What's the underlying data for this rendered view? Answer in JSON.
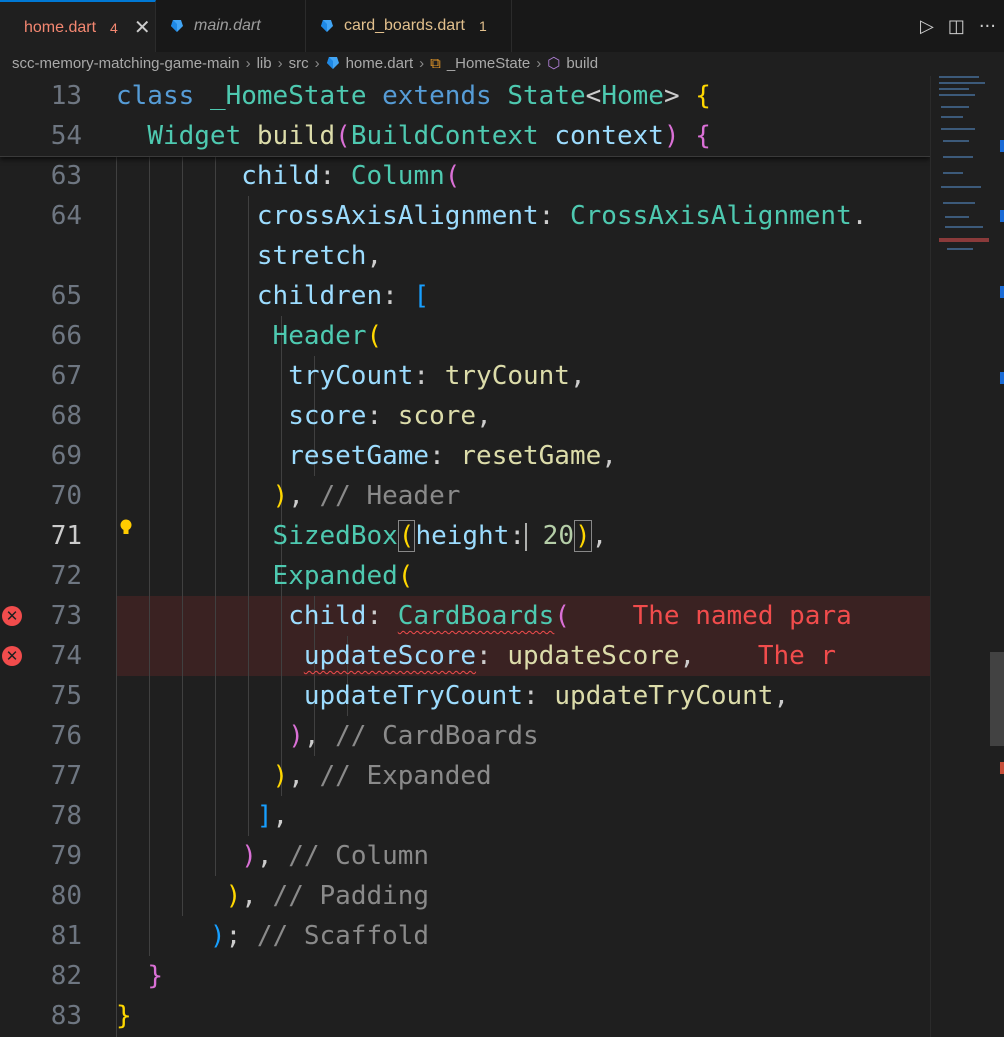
{
  "tabs": [
    {
      "label": "home.dart",
      "badge": "4",
      "state": "error",
      "active": true
    },
    {
      "label": "main.dart",
      "badge": "",
      "state": "plain",
      "active": false
    },
    {
      "label": "card_boards.dart",
      "badge": "1",
      "state": "warning",
      "active": false
    }
  ],
  "tab_actions": {
    "run": "▷",
    "split": "◫",
    "more": "···"
  },
  "breadcrumb": [
    "scc-memory-matching-game-main",
    "lib",
    "src",
    "home.dart",
    "_HomeState",
    "build"
  ],
  "sticky": [
    {
      "num": "13"
    },
    {
      "num": "54"
    }
  ],
  "lines": [
    {
      "num": "63"
    },
    {
      "num": "64"
    },
    {
      "num": ""
    },
    {
      "num": "65"
    },
    {
      "num": "66"
    },
    {
      "num": "67"
    },
    {
      "num": "68"
    },
    {
      "num": "69"
    },
    {
      "num": "70"
    },
    {
      "num": "71"
    },
    {
      "num": "72"
    },
    {
      "num": "73"
    },
    {
      "num": "74"
    },
    {
      "num": "75"
    },
    {
      "num": "76"
    },
    {
      "num": "77"
    },
    {
      "num": "78"
    },
    {
      "num": "79"
    },
    {
      "num": "80"
    },
    {
      "num": "81"
    },
    {
      "num": "82"
    },
    {
      "num": "83"
    }
  ],
  "code": {
    "l13": {
      "t1": "class",
      "t2": "_HomeState",
      "t3": "extends",
      "t4": "State",
      "t5": "<",
      "t6": "Home",
      "t7": ">",
      "t8": "{"
    },
    "l54": {
      "t1": "Widget",
      "t2": "build",
      "t3": "(",
      "t4": "BuildContext",
      "t5": "context",
      "t6": ")",
      "t7": "{"
    },
    "l63": {
      "t1": "child",
      "t2": ": ",
      "t3": "Column",
      "t4": "("
    },
    "l64": {
      "t1": "crossAxisAlignment",
      "t2": ": ",
      "t3": "CrossAxisAlignment",
      "t4": "."
    },
    "l64b": {
      "t1": "stretch",
      "t2": ","
    },
    "l65": {
      "t1": "children",
      "t2": ": ",
      "t3": "["
    },
    "l66": {
      "t1": "Header",
      "t2": "("
    },
    "l67": {
      "t1": "tryCount",
      "t2": ": ",
      "t3": "tryCount",
      "t4": ","
    },
    "l68": {
      "t1": "score",
      "t2": ": ",
      "t3": "score",
      "t4": ","
    },
    "l69": {
      "t1": "resetGame",
      "t2": ": ",
      "t3": "resetGame",
      "t4": ","
    },
    "l70": {
      "t1": ")",
      "t2": ", ",
      "t3": "// Header"
    },
    "l71": {
      "t1": "SizedBox",
      "t2": "(",
      "t3": "height",
      "t4": ":",
      "t5": " 20",
      "t6": ")",
      "t7": ","
    },
    "l72": {
      "t1": "Expanded",
      "t2": "("
    },
    "l73": {
      "t1": "child",
      "t2": ": ",
      "t3": "CardBoards",
      "t4": "(",
      "err": "The named para"
    },
    "l74": {
      "t1": "updateScore",
      "t2": ": ",
      "t3": "updateScore",
      "t4": ",",
      "err": "The r"
    },
    "l75": {
      "t1": "updateTryCount",
      "t2": ": ",
      "t3": "updateTryCount",
      "t4": ","
    },
    "l76": {
      "t1": ")",
      "t2": ", ",
      "t3": "// CardBoards"
    },
    "l77": {
      "t1": ")",
      "t2": ", ",
      "t3": "// Expanded"
    },
    "l78": {
      "t1": "]",
      "t2": ","
    },
    "l79": {
      "t1": ")",
      "t2": ", ",
      "t3": "// Column"
    },
    "l80": {
      "t1": ")",
      "t2": ", ",
      "t3": "// Padding"
    },
    "l81": {
      "t1": ")",
      "t2": "; ",
      "t3": "// Scaffold"
    },
    "l82": {
      "t1": "}"
    },
    "l83": {
      "t1": "}"
    }
  },
  "colors": {
    "accent": "#0078d4",
    "error": "#f14c4c",
    "background": "#1f1f1f"
  }
}
